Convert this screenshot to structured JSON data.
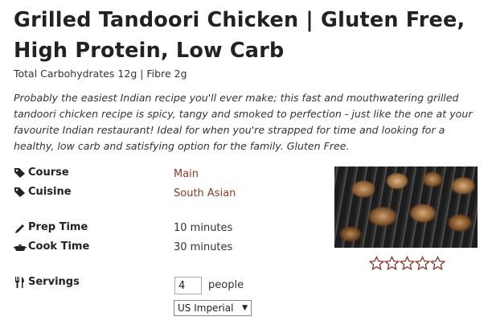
{
  "recipe": {
    "title": "Grilled Tandoori Chicken | Gluten Free, High Protein, Low Carb",
    "nutrition_summary": "Total Carbohydrates 12g | Fibre 2g",
    "summary": "Probably the easiest Indian recipe you'll ever make; this fast and mouthwatering grilled tandoori chicken recipe is spicy, tangy and smoked to perfection - just like the one at your favourite Indian restaurant! Ideal for when you're strapped for time and looking for a healthy, low carb and satisfying option for the family. Gluten Free.",
    "meta": {
      "course_label": "Course",
      "course_value": "Main",
      "cuisine_label": "Cuisine",
      "cuisine_value": "South Asian",
      "prep_label": "Prep Time",
      "prep_value": "10 minutes",
      "cook_label": "Cook Time",
      "cook_value": "30 minutes",
      "servings_label": "Servings",
      "servings_value": "4",
      "servings_unit": "people",
      "unit_system": "US Imperial"
    },
    "rating": {
      "value": 0,
      "max": 5
    },
    "icons": {
      "course": "tag-icon",
      "cuisine": "tag-icon",
      "prep": "pencil-icon",
      "cook": "pot-icon",
      "servings": "fork-knife-icon"
    },
    "colors": {
      "accent": "#8b3a2b",
      "star_outline": "#8b3a2b"
    }
  }
}
